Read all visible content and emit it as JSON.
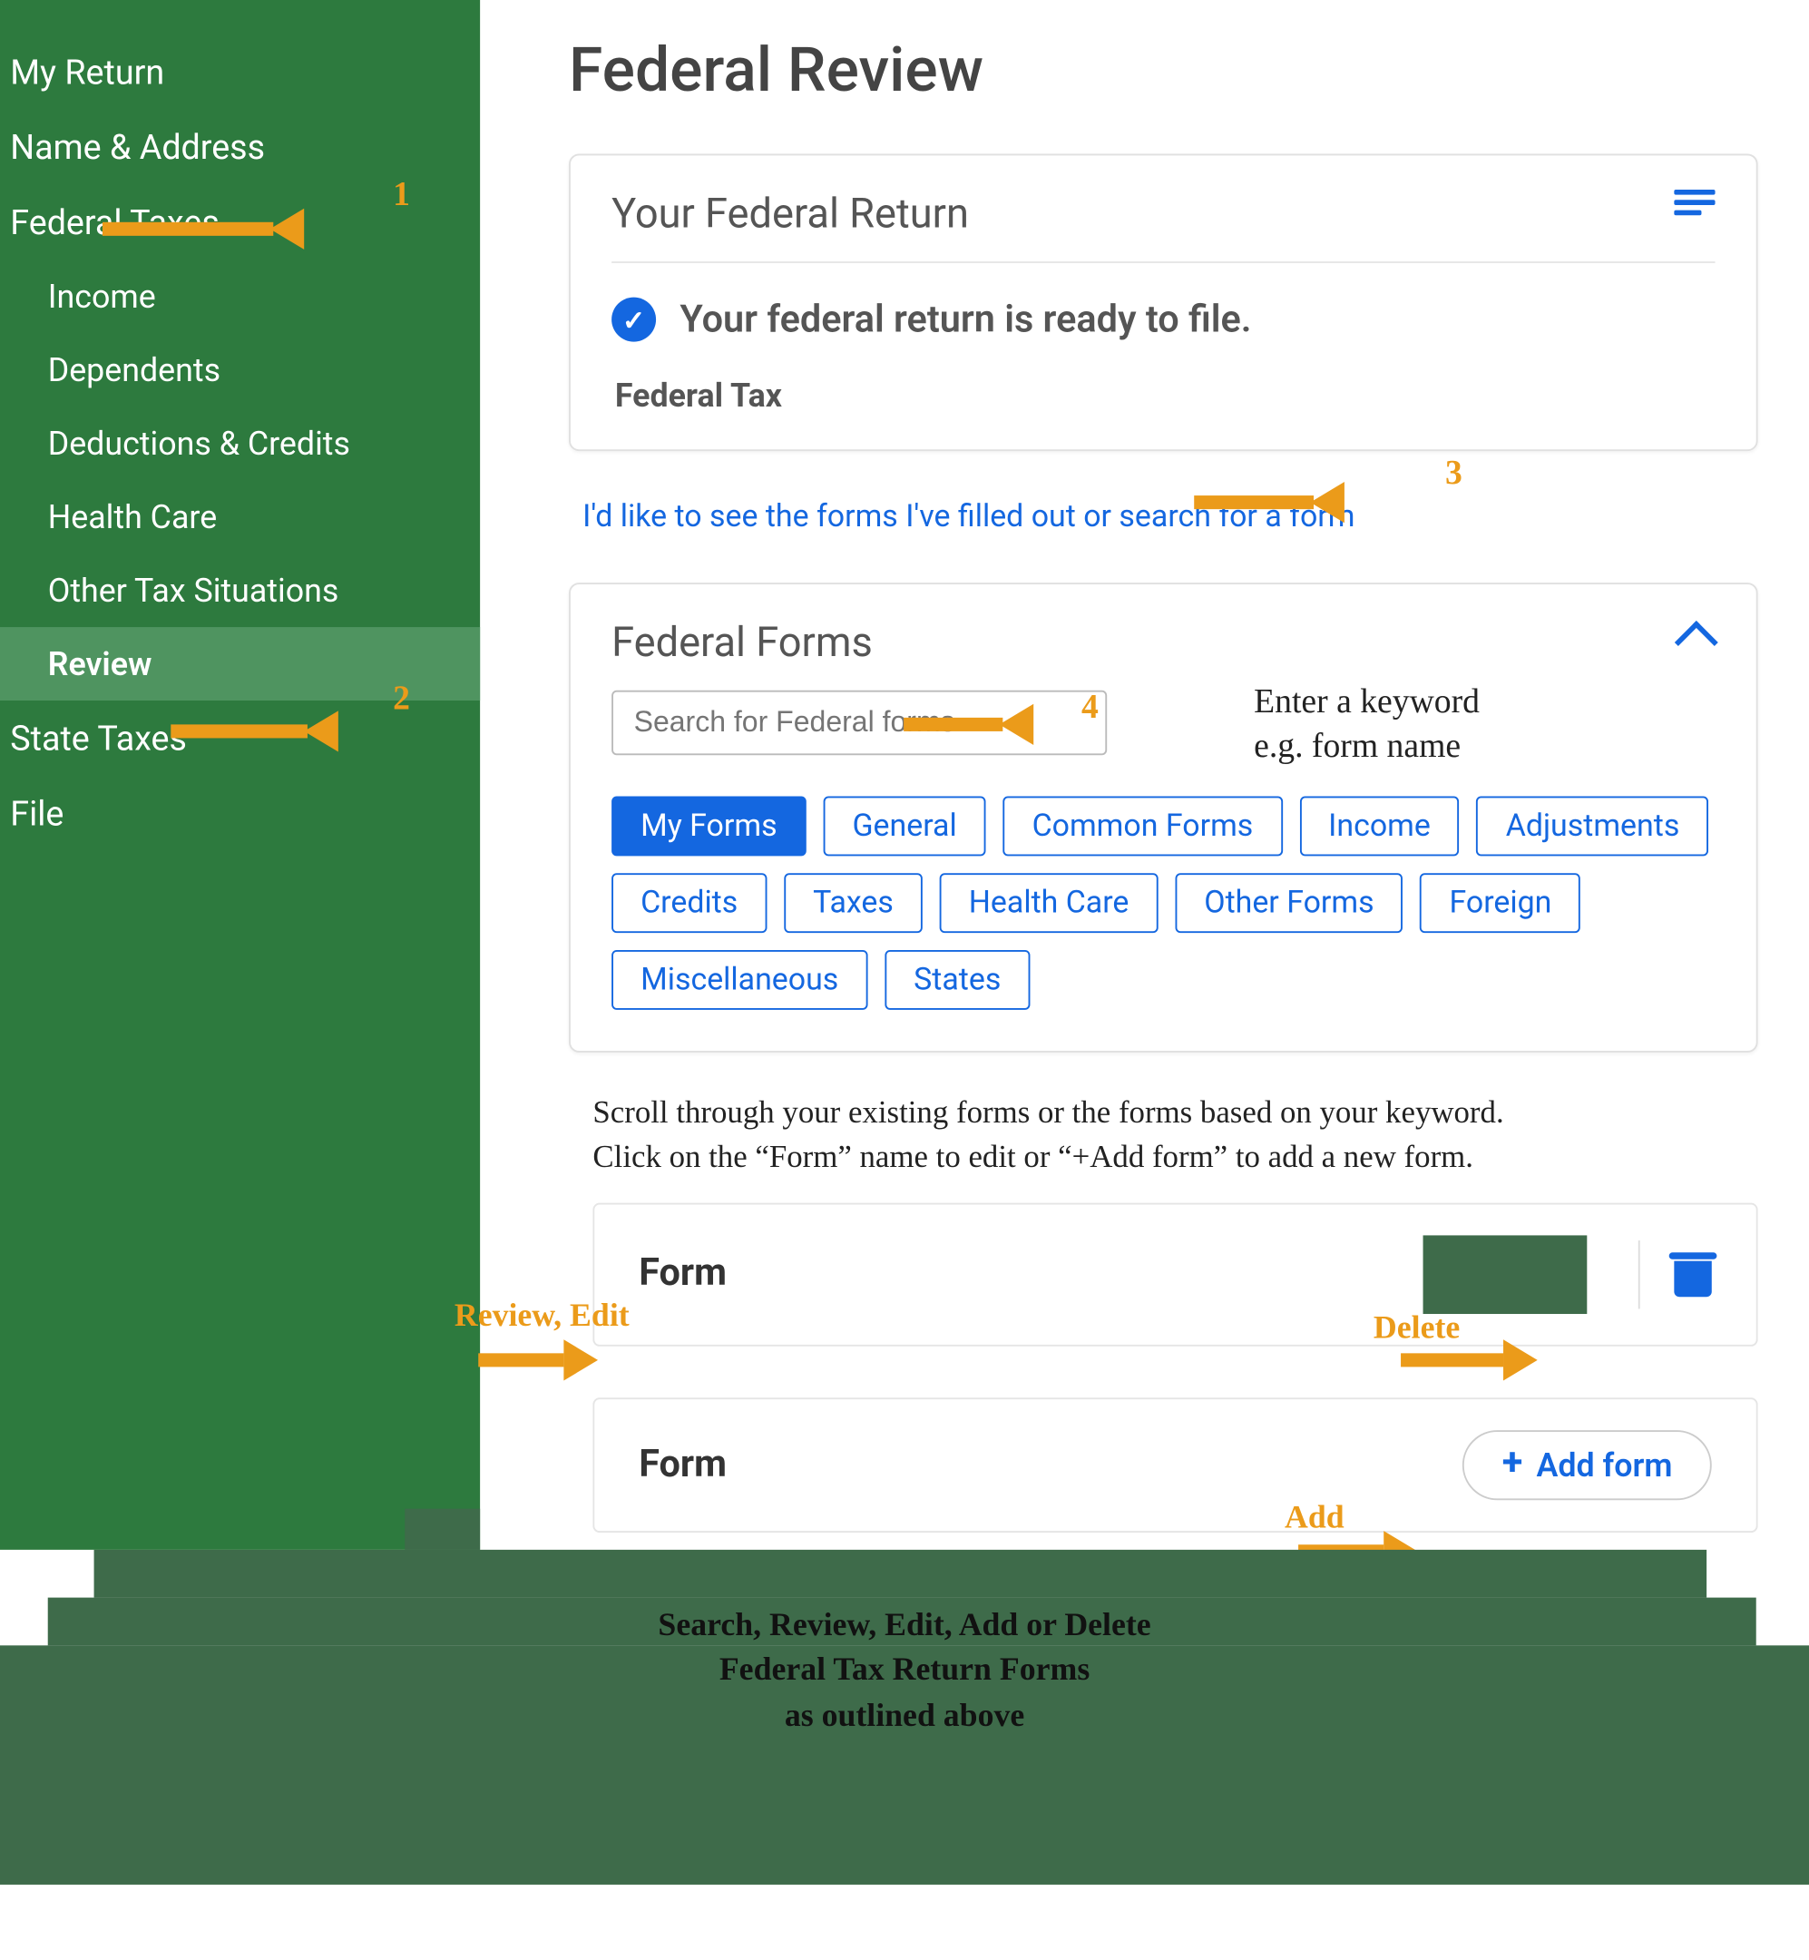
{
  "sidebar": {
    "items": [
      {
        "label": "My Return",
        "type": "top"
      },
      {
        "label": "Name & Address",
        "type": "top"
      },
      {
        "label": "Federal Taxes",
        "type": "top"
      },
      {
        "label": "Income",
        "type": "sub"
      },
      {
        "label": "Dependents",
        "type": "sub"
      },
      {
        "label": "Deductions & Credits",
        "type": "sub"
      },
      {
        "label": "Health Care",
        "type": "sub"
      },
      {
        "label": "Other Tax Situations",
        "type": "sub"
      },
      {
        "label": "Review",
        "type": "sub",
        "active": true
      },
      {
        "label": "State Taxes",
        "type": "top"
      },
      {
        "label": "File",
        "type": "top"
      }
    ]
  },
  "page": {
    "title": "Federal Review"
  },
  "return_card": {
    "title": "Your Federal Return",
    "status": "Your federal return is ready to file.",
    "label": "Federal Tax"
  },
  "forms_link": "I'd like to see the forms I've filled out or search for a form",
  "forms_card": {
    "title": "Federal Forms",
    "search_placeholder": "Search for Federal forms",
    "hint_line1": "Enter a keyword",
    "hint_line2": "e.g. form name",
    "chips": [
      "My Forms",
      "General",
      "Common Forms",
      "Income",
      "Adjustments",
      "Credits",
      "Taxes",
      "Health Care",
      "Other Forms",
      "Foreign",
      "Miscellaneous",
      "States"
    ],
    "active_chip": "My Forms"
  },
  "instruction": "Scroll through your existing forms or the forms based on your keyword.\nClick on the “Form” name to edit or “+Add form” to add a new form.",
  "form_rows": {
    "row1_label": "Form",
    "row2_label": "Form",
    "add_label": "Add form"
  },
  "annotations": {
    "n1": "1",
    "n2": "2",
    "n3": "3",
    "n4": "4",
    "review_edit": "Review, Edit",
    "delete": "Delete",
    "add": "Add"
  },
  "footer": {
    "line1": "Search, Review, Edit, Add or Delete",
    "line2": "Federal Tax Return Forms",
    "line3": "as outlined above"
  }
}
